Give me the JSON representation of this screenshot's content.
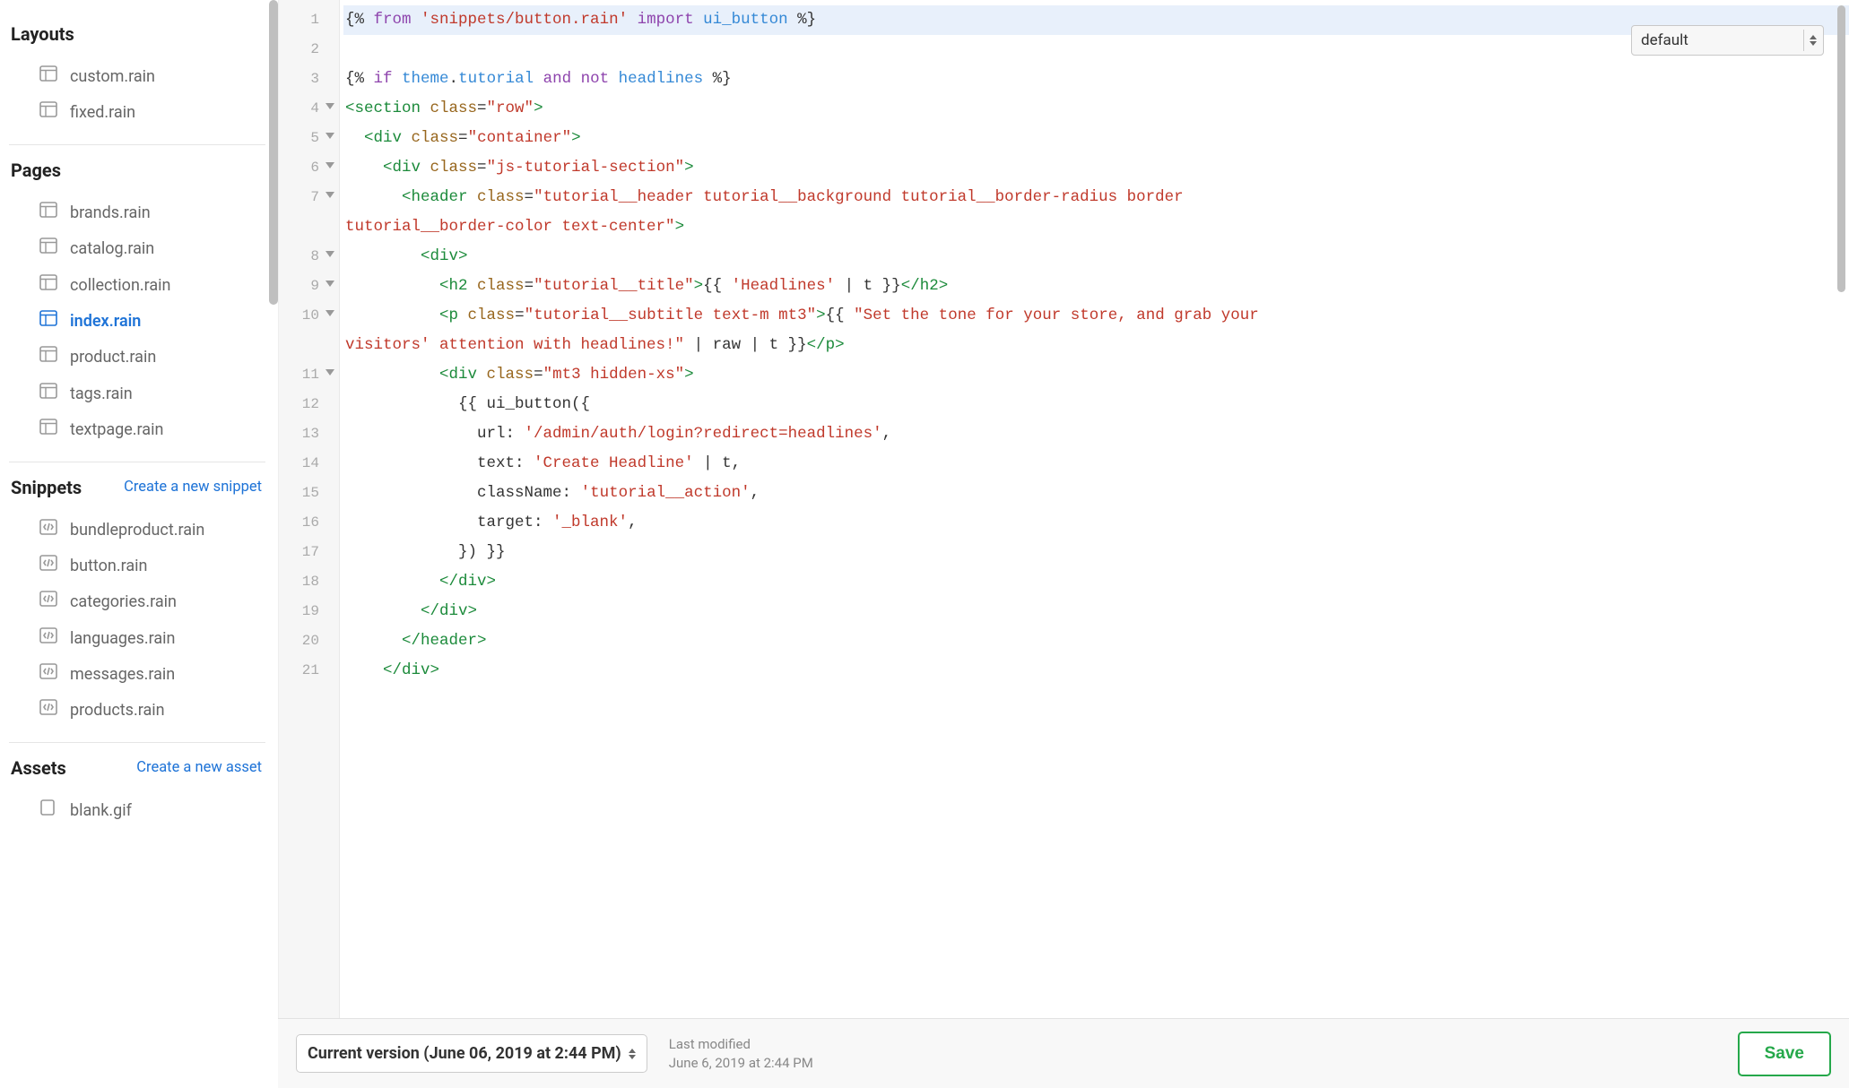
{
  "sidebar": {
    "layouts": {
      "title": "Layouts",
      "items": [
        "custom.rain",
        "fixed.rain"
      ]
    },
    "pages": {
      "title": "Pages",
      "items": [
        "brands.rain",
        "catalog.rain",
        "collection.rain",
        "index.rain",
        "product.rain",
        "tags.rain",
        "textpage.rain"
      ],
      "selected_index": 3
    },
    "snippets": {
      "title": "Snippets",
      "create_label": "Create a new snippet",
      "items": [
        "bundleproduct.rain",
        "button.rain",
        "categories.rain",
        "languages.rain",
        "messages.rain",
        "products.rain"
      ]
    },
    "assets": {
      "title": "Assets",
      "create_label": "Create a new asset",
      "items": [
        "blank.gif"
      ]
    }
  },
  "editor": {
    "language_dropdown": "default",
    "gutter": [
      {
        "n": "1"
      },
      {
        "n": "2"
      },
      {
        "n": "3"
      },
      {
        "n": "4",
        "fold": true
      },
      {
        "n": "5",
        "fold": true
      },
      {
        "n": "6",
        "fold": true
      },
      {
        "n": "7",
        "fold": true
      },
      {
        "n": "",
        "extra": true
      },
      {
        "n": "8",
        "fold": true
      },
      {
        "n": "9",
        "fold": true
      },
      {
        "n": "10",
        "fold": true
      },
      {
        "n": "",
        "extra": true
      },
      {
        "n": "11",
        "fold": true
      },
      {
        "n": "12"
      },
      {
        "n": "13"
      },
      {
        "n": "14"
      },
      {
        "n": "15"
      },
      {
        "n": "16"
      },
      {
        "n": "17"
      },
      {
        "n": "18"
      },
      {
        "n": "19"
      },
      {
        "n": "20"
      },
      {
        "n": "21"
      }
    ],
    "code": {
      "l1": {
        "a": "{% ",
        "b": "from ",
        "c": "'snippets/button.rain' ",
        "d": "import ",
        "e": "ui_button ",
        "f": "%}"
      },
      "l2": "",
      "l3": {
        "a": "{% ",
        "b": "if ",
        "c": "theme",
        "d": ".",
        "e": "tutorial ",
        "f": "and not ",
        "g": "headlines ",
        "h": "%}"
      },
      "l4": {
        "a": "<section ",
        "b": "class",
        "c": "=",
        "d": "\"row\"",
        "e": ">"
      },
      "l5": {
        "pad": "  ",
        "a": "<div ",
        "b": "class",
        "c": "=",
        "d": "\"container\"",
        "e": ">"
      },
      "l6": {
        "pad": "    ",
        "a": "<div ",
        "b": "class",
        "c": "=",
        "d": "\"js-tutorial-section\"",
        "e": ">"
      },
      "l7a": {
        "pad": "      ",
        "a": "<header ",
        "b": "class",
        "c": "=",
        "d": "\"tutorial__header tutorial__background tutorial__border-radius border "
      },
      "l7b": {
        "d": "tutorial__border-color text-center\"",
        "e": ">"
      },
      "l8": {
        "pad": "        ",
        "a": "<div>"
      },
      "l9": {
        "pad": "          ",
        "a": "<h2 ",
        "b": "class",
        "c": "=",
        "d": "\"tutorial__title\"",
        "e": ">",
        "f": "{{ ",
        "g": "'Headlines' ",
        "h": "| t }}",
        "i": "</h2>"
      },
      "l10a": {
        "pad": "          ",
        "a": "<p ",
        "b": "class",
        "c": "=",
        "d": "\"tutorial__subtitle text-m mt3\"",
        "e": ">",
        "f": "{{ ",
        "g": "\"Set the tone for your store, and grab your "
      },
      "l10b": {
        "g": "visitors' attention with headlines!\" ",
        "h": "| raw | t }}",
        "i": "</p>"
      },
      "l11": {
        "pad": "          ",
        "a": "<div ",
        "b": "class",
        "c": "=",
        "d": "\"mt3 hidden-xs\"",
        "e": ">"
      },
      "l12": {
        "pad": "            ",
        "a": "{{ ui_button({"
      },
      "l13": {
        "pad": "              ",
        "a": "url: ",
        "b": "'/admin/auth/login?redirect=headlines'",
        "c": ","
      },
      "l14": {
        "pad": "              ",
        "a": "text: ",
        "b": "'Create Headline' ",
        "c": "| t,"
      },
      "l15": {
        "pad": "              ",
        "a": "className: ",
        "b": "'tutorial__action'",
        "c": ","
      },
      "l16": {
        "pad": "              ",
        "a": "target: ",
        "b": "'_blank'",
        "c": ","
      },
      "l17": {
        "pad": "            ",
        "a": "}) }}"
      },
      "l18": {
        "pad": "          ",
        "a": "</div>"
      },
      "l19": {
        "pad": "        ",
        "a": "</div>"
      },
      "l20": {
        "pad": "      ",
        "a": "</header>"
      },
      "l21": {
        "pad": "    ",
        "a": "</div>"
      }
    }
  },
  "footer": {
    "version_label": "Current version (June 06, 2019 at 2:44 PM)",
    "last_modified_label": "Last modified",
    "last_modified_value": "June 6, 2019 at 2:44 PM",
    "save_label": "Save"
  }
}
